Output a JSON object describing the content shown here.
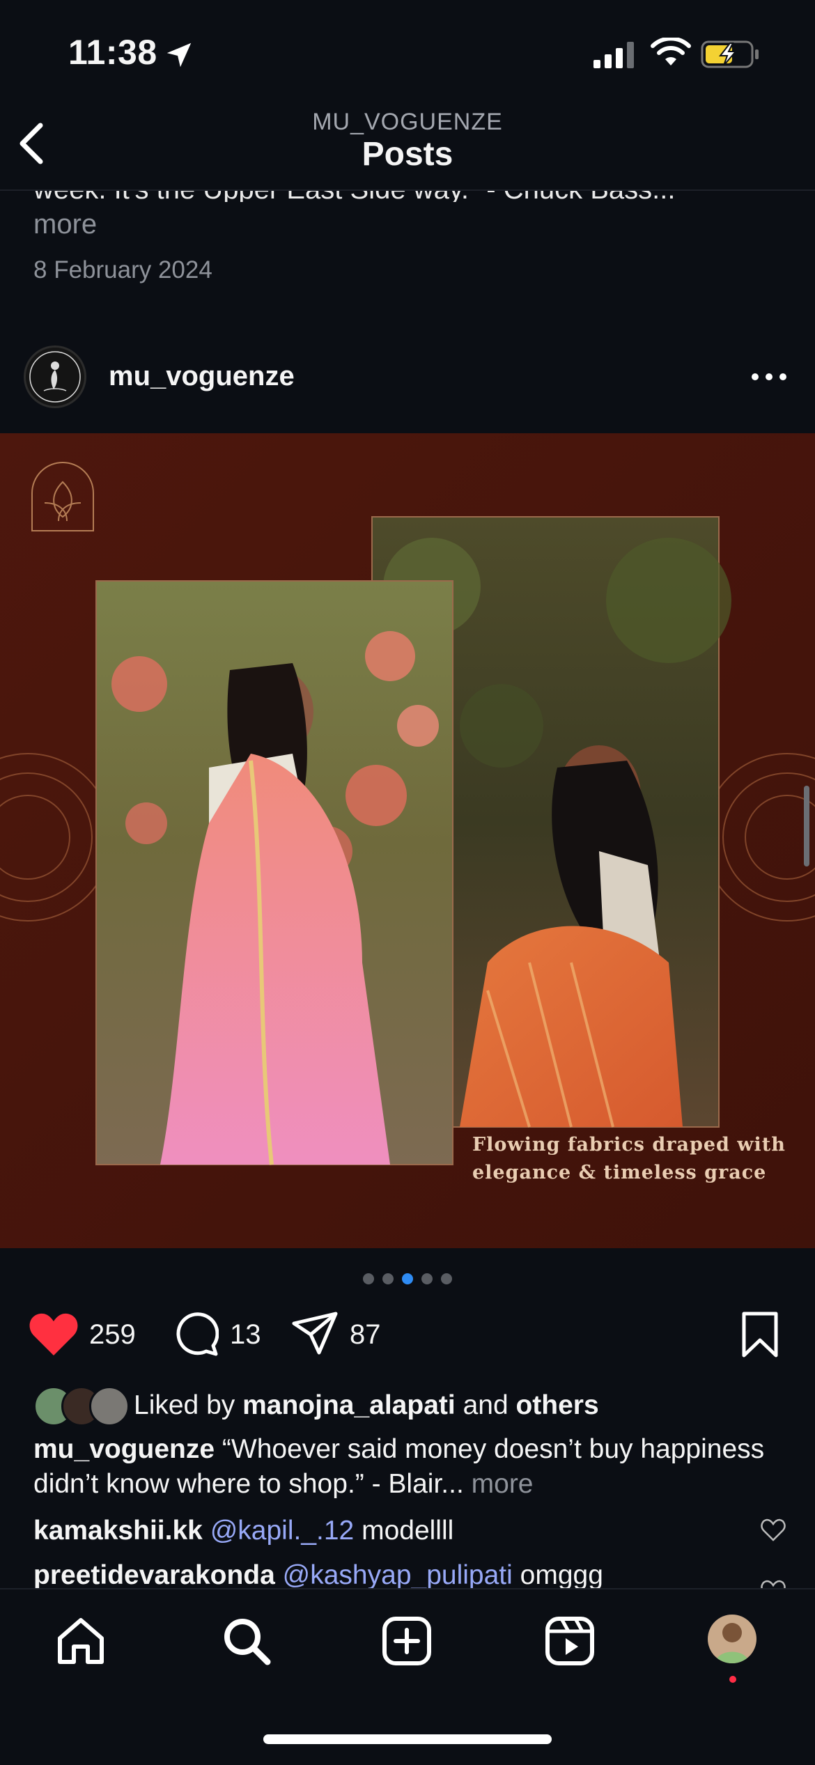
{
  "status_bar": {
    "time": "11:38"
  },
  "header": {
    "account": "MU_VOGUENZE",
    "title": "Posts"
  },
  "previous_post": {
    "caption_tail": "week. It's the Upper East Side way.\" - Chuck Bass...",
    "more_label": "more",
    "date": "8 February 2024"
  },
  "post": {
    "username": "mu_voguenze",
    "image_text_line1": "Flowing fabrics draped with",
    "image_text_line2": "elegance & timeless grace",
    "carousel": {
      "count": 5,
      "active_index": 2
    },
    "likes": "259",
    "comments": "13",
    "shares": "87",
    "liked_by_prefix": "Liked by",
    "liked_by_user": "manojna_alapati",
    "liked_by_and": "and",
    "liked_by_others": "others",
    "caption_user": "mu_voguenze",
    "caption_text": " “Whoever said money doesn’t buy happiness didn’t know where to shop.” - Blair...",
    "caption_more": "more",
    "comment_list": [
      {
        "user": "kamakshii.kk",
        "mention": "@kapil._.12",
        "text": "modellll"
      },
      {
        "user": "preetidevarakonda",
        "mention": "@kashyap_pulipati",
        "text": "omggg"
      }
    ]
  },
  "colors": {
    "background": "#0b0e14",
    "like_red": "#ff3040",
    "mention_blue": "#98a9f7",
    "carousel_active": "#2f8cf4",
    "image_bg": "#4a160d"
  },
  "tab_bar": {
    "items": [
      {
        "icon": "home-icon"
      },
      {
        "icon": "search-icon"
      },
      {
        "icon": "create-icon"
      },
      {
        "icon": "reels-icon"
      },
      {
        "icon": "profile-avatar"
      }
    ]
  }
}
